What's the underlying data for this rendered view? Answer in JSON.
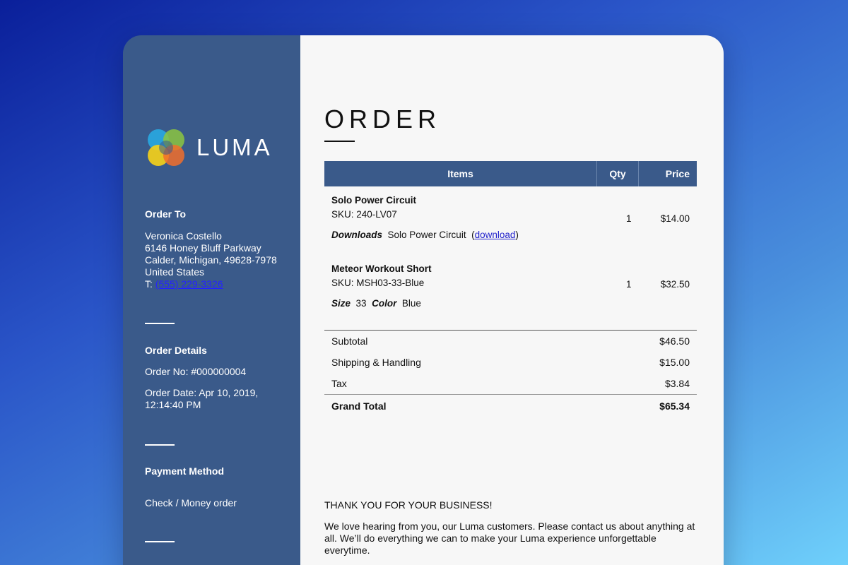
{
  "brand": {
    "name": "LUMA",
    "colors": {
      "sidebar": "#3a5a8a",
      "background_start": "#0a1f9a",
      "background_end": "#6fd0fb"
    }
  },
  "sidebar": {
    "order_to": {
      "heading": "Order To",
      "name": "Veronica Costello",
      "street": "6146 Honey Bluff Parkway",
      "city_line": "Calder, Michigan, 49628-7978",
      "country": "United States",
      "phone_label": "T:",
      "phone": "(555) 229-3326"
    },
    "order_details": {
      "heading": "Order Details",
      "order_no": "Order No: #000000004",
      "order_date_line1": "Order Date: Apr 10, 2019,",
      "order_date_line2": "12:14:40 PM"
    },
    "payment": {
      "heading": "Payment Method",
      "method": "Check / Money order"
    }
  },
  "main": {
    "title": "ORDER",
    "table": {
      "headers": {
        "items": "Items",
        "qty": "Qty",
        "price": "Price"
      },
      "rows": [
        {
          "name": "Solo Power Circuit",
          "sku": "SKU: 240-LV07",
          "opt1_key": "Downloads",
          "opt1_val": "Solo Power Circuit",
          "link_open": "(",
          "link_text": "download",
          "link_close": ")",
          "qty": "1",
          "price": "$14.00"
        },
        {
          "name": "Meteor Workout Short",
          "sku": "SKU: MSH03-33-Blue",
          "opt1_key": "Size",
          "opt1_val": "33",
          "opt2_key": "Color",
          "opt2_val": "Blue",
          "qty": "1",
          "price": "$32.50"
        }
      ]
    },
    "totals": {
      "subtotal_label": "Subtotal",
      "subtotal": "$46.50",
      "shipping_label": "Shipping & Handling",
      "shipping": "$15.00",
      "tax_label": "Tax",
      "tax": "$3.84",
      "grand_label": "Grand Total",
      "grand": "$65.34"
    },
    "thanks": {
      "heading": "THANK YOU FOR YOUR BUSINESS!",
      "message": "We love hearing from you, our Luma customers. Please contact us about anything at all. We’ll do everything we can to make your Luma experience unforgettable everytime."
    }
  }
}
